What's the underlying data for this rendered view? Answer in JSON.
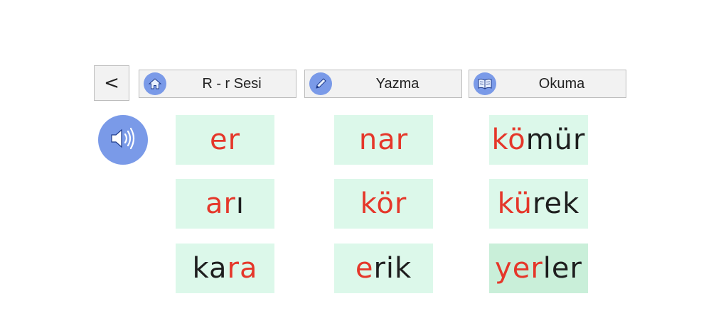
{
  "toolbar": {
    "back_label": "<",
    "home_label": "R - r Sesi",
    "write_label": "Yazma",
    "read_label": "Okuma"
  },
  "icons": {
    "home": "home-icon",
    "write": "pencil-icon",
    "read": "book-icon",
    "sound": "speaker-icon"
  },
  "colors": {
    "accent": "#7a9ae8",
    "highlight": "#e5372a",
    "text": "#1e1e1e",
    "card": "#dcf8ea"
  },
  "words": [
    [
      {
        "s": [
          {
            "t": "er",
            "c": "red"
          }
        ]
      },
      {
        "s": [
          {
            "t": "nar",
            "c": "red"
          }
        ]
      },
      {
        "s": [
          {
            "t": "kö",
            "c": "red"
          },
          {
            "t": "mür",
            "c": "dark"
          }
        ]
      }
    ],
    [
      {
        "s": [
          {
            "t": "ar",
            "c": "red"
          },
          {
            "t": "ı",
            "c": "dark"
          }
        ]
      },
      {
        "s": [
          {
            "t": "kör",
            "c": "red"
          }
        ]
      },
      {
        "s": [
          {
            "t": "kü",
            "c": "red"
          },
          {
            "t": "rek",
            "c": "dark"
          }
        ]
      }
    ],
    [
      {
        "s": [
          {
            "t": "ka",
            "c": "dark"
          },
          {
            "t": "ra",
            "c": "red"
          }
        ]
      },
      {
        "s": [
          {
            "t": "e",
            "c": "red"
          },
          {
            "t": "rik",
            "c": "dark"
          }
        ]
      },
      {
        "s": [
          {
            "t": "yer",
            "c": "red"
          },
          {
            "t": "ler",
            "c": "dark"
          }
        ]
      }
    ]
  ]
}
